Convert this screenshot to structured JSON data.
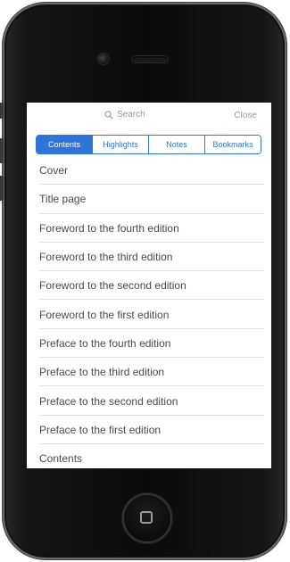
{
  "top_bar": {
    "search_label": "Search",
    "close_label": "Close"
  },
  "tabs": [
    {
      "label": "Contents",
      "active": true
    },
    {
      "label": "Highlights",
      "active": false
    },
    {
      "label": "Notes",
      "active": false
    },
    {
      "label": "Bookmarks",
      "active": false
    }
  ],
  "toc_items": [
    {
      "label": "Cover"
    },
    {
      "label": "Title page"
    },
    {
      "label": "Foreword to the fourth edition"
    },
    {
      "label": "Foreword to the third edition"
    },
    {
      "label": "Foreword to the second edition"
    },
    {
      "label": "Foreword to the first edition"
    },
    {
      "label": "Preface to the fourth edition"
    },
    {
      "label": "Preface to the third edition"
    },
    {
      "label": "Preface to the second edition"
    },
    {
      "label": "Preface to the first edition"
    },
    {
      "label": "Contents"
    }
  ],
  "colors": {
    "accent": "#2f74d8",
    "text": "#4a4a4a",
    "muted": "#9b9b9b",
    "phone_body": "#0b0b0b"
  },
  "icons": {
    "search": "search-icon",
    "home": "home-button-icon"
  }
}
